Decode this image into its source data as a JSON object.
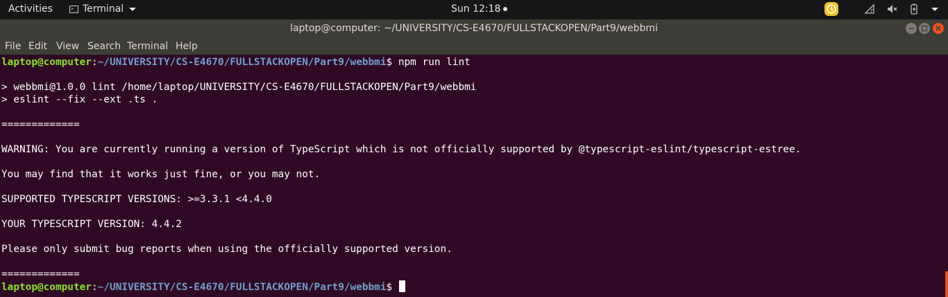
{
  "topbar": {
    "activities": "Activities",
    "app_menu": "Terminal",
    "clock": "Sun 12:18"
  },
  "window": {
    "title": "laptop@computer: ~/UNIVERSITY/CS-E4670/FULLSTACKOPEN/Part9/webbmi"
  },
  "menubar": {
    "items": [
      "File",
      "Edit",
      "View",
      "Search",
      "Terminal",
      "Help"
    ]
  },
  "terminal": {
    "prompt_user": "laptop@computer",
    "prompt_sep": ":",
    "prompt_path": "~/UNIVERSITY/CS-E4670/FULLSTACKOPEN/Part9/webbmi",
    "prompt_symbol": "$",
    "command": " npm run lint",
    "lines": [
      "> webbmi@1.0.0 lint /home/laptop/UNIVERSITY/CS-E4670/FULLSTACKOPEN/Part9/webbmi",
      "> eslint --fix --ext .ts .",
      "=============",
      "WARNING: You are currently running a version of TypeScript which is not officially supported by @typescript-eslint/typescript-estree.",
      "You may find that it works just fine, or you may not.",
      "SUPPORTED TYPESCRIPT VERSIONS: >=3.3.1 <4.4.0",
      "YOUR TYPESCRIPT VERSION: 4.4.2",
      "Please only submit bug reports when using the officially supported version.",
      "============="
    ]
  },
  "colors": {
    "terminal_bg": "#300a24",
    "prompt_user": "#8ae234",
    "prompt_path": "#729fcf",
    "accent": "#e95420"
  }
}
